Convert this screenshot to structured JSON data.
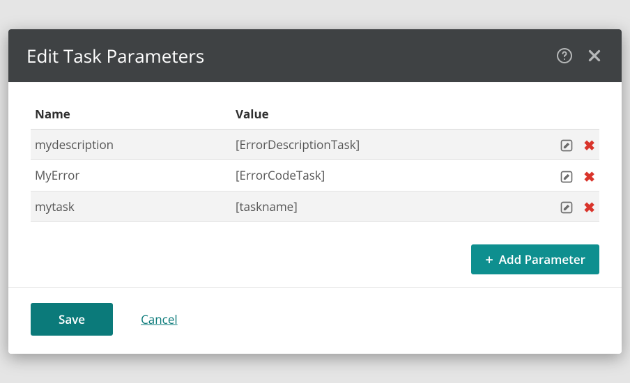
{
  "dialog": {
    "title": "Edit Task Parameters"
  },
  "table": {
    "headers": {
      "name": "Name",
      "value": "Value"
    },
    "rows": [
      {
        "name": "mydescription",
        "value": "[ErrorDescriptionTask]"
      },
      {
        "name": "MyError",
        "value": "[ErrorCodeTask]"
      },
      {
        "name": "mytask",
        "value": "[taskname]"
      }
    ]
  },
  "buttons": {
    "add": "Add Parameter",
    "save": "Save",
    "cancel": "Cancel"
  },
  "icons": {
    "help": "help-icon",
    "close": "close-icon",
    "edit": "edit-icon",
    "delete": "delete-icon",
    "plus": "plus-icon"
  },
  "colors": {
    "header_bg": "#3f4244",
    "teal": "#0e8f8f",
    "teal_dark": "#0b7a7a",
    "danger": "#d9342b"
  }
}
